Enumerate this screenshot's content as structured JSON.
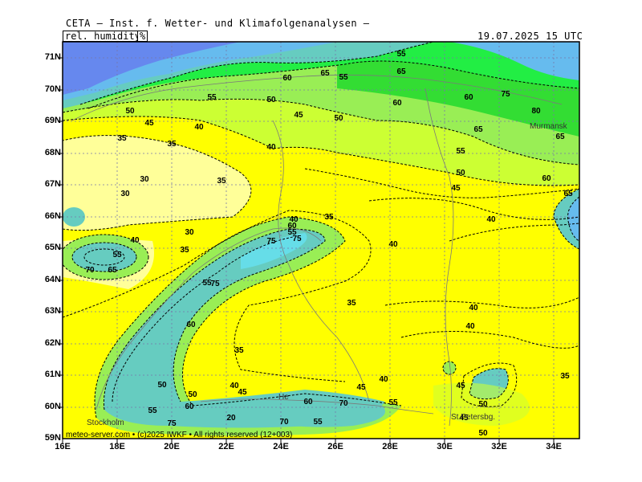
{
  "header": {
    "source": "CETA — Inst. f. Wetter- und Klimafolgenanalysen —",
    "parameter": "rel._humidity",
    "unit": "%",
    "datetime": "19.07.2025 15 UTC"
  },
  "axes": {
    "lat": [
      "71N",
      "70N",
      "69N",
      "68N",
      "67N",
      "66N",
      "65N",
      "64N",
      "63N",
      "62N",
      "61N",
      "60N",
      "59N"
    ],
    "lon": [
      "16E",
      "18E",
      "20E",
      "22E",
      "24E",
      "26E",
      "28E",
      "30E",
      "32E",
      "34E"
    ]
  },
  "places": {
    "murmansk": "Murmansk",
    "stockholm": "Stockholm",
    "st_petersburg": "St.Petersbg.",
    "helsinki": "He"
  },
  "footer": "meteo-server.com • (c)2025 IWKF • All rights reserved (12+003)",
  "contour_labels": [
    {
      "v": "55"
    },
    {
      "v": "65"
    },
    {
      "v": "60"
    },
    {
      "v": "65"
    },
    {
      "v": "55"
    },
    {
      "v": "50"
    },
    {
      "v": "60"
    },
    {
      "v": "60"
    },
    {
      "v": "75"
    },
    {
      "v": "80"
    },
    {
      "v": "55"
    },
    {
      "v": "50"
    },
    {
      "v": "45"
    },
    {
      "v": "40"
    },
    {
      "v": "35"
    },
    {
      "v": "45"
    },
    {
      "v": "50"
    },
    {
      "v": "65"
    },
    {
      "v": "65"
    },
    {
      "v": "40"
    },
    {
      "v": "35"
    },
    {
      "v": "55"
    },
    {
      "v": "50"
    },
    {
      "v": "45"
    },
    {
      "v": "60"
    },
    {
      "v": "65"
    },
    {
      "v": "30"
    },
    {
      "v": "35"
    },
    {
      "v": "30"
    },
    {
      "v": "35"
    },
    {
      "v": "40"
    },
    {
      "v": "40"
    },
    {
      "v": "60"
    },
    {
      "v": "55"
    },
    {
      "v": "30"
    },
    {
      "v": "40"
    },
    {
      "v": "55"
    },
    {
      "v": "75"
    },
    {
      "v": "65"
    },
    {
      "v": "70"
    },
    {
      "v": "40"
    },
    {
      "v": "75"
    },
    {
      "v": "35"
    },
    {
      "v": "35"
    },
    {
      "v": "40"
    },
    {
      "v": "40"
    },
    {
      "v": "60"
    },
    {
      "v": "35"
    },
    {
      "v": "40"
    },
    {
      "v": "50"
    },
    {
      "v": "45"
    },
    {
      "v": "55"
    },
    {
      "v": "40"
    },
    {
      "v": "45"
    },
    {
      "v": "50"
    },
    {
      "v": "60"
    },
    {
      "v": "75"
    },
    {
      "v": "55"
    },
    {
      "v": "70"
    },
    {
      "v": "60"
    },
    {
      "v": "55"
    },
    {
      "v": "70"
    },
    {
      "v": "55"
    },
    {
      "v": "20"
    },
    {
      "v": "75"
    },
    {
      "v": "45"
    },
    {
      "v": "50"
    },
    {
      "v": "45"
    },
    {
      "v": "35"
    },
    {
      "v": "50"
    }
  ],
  "colors": {
    "yellow": "#ffff00",
    "pale_yellow": "#ffff99",
    "yellow_green": "#ccff33",
    "light_green": "#99ee55",
    "green": "#33dd33",
    "bright_green": "#22ee44",
    "teal": "#66ccc0",
    "cyan": "#66dde8",
    "light_blue": "#66bbee",
    "blue": "#6688ee"
  }
}
